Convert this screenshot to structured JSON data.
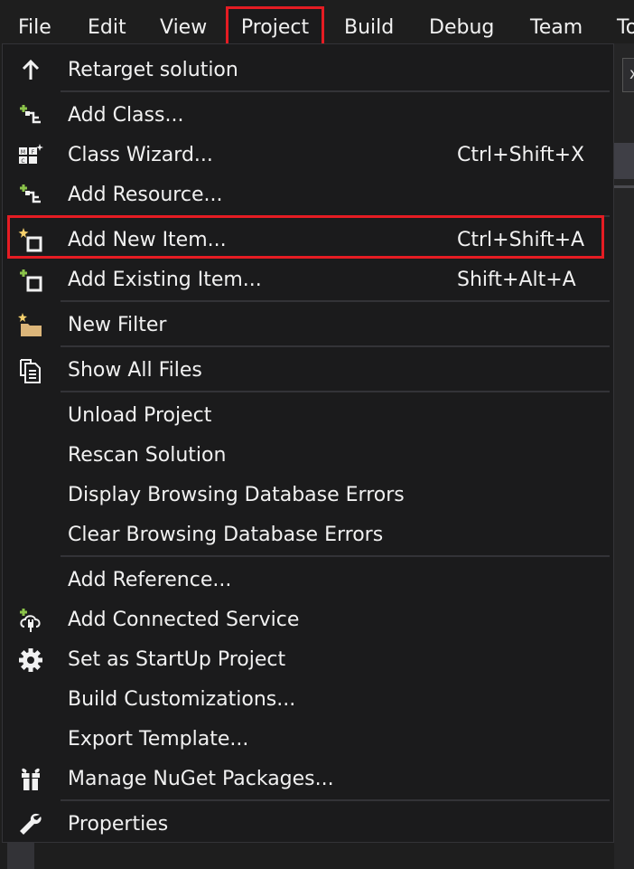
{
  "menubar": {
    "items": [
      {
        "label": "File"
      },
      {
        "label": "Edit"
      },
      {
        "label": "View"
      },
      {
        "label": "Project"
      },
      {
        "label": "Build"
      },
      {
        "label": "Debug"
      },
      {
        "label": "Team"
      },
      {
        "label": "To"
      }
    ]
  },
  "background": {
    "tab_close": "x"
  },
  "dropdown": {
    "items": [
      {
        "label": "Retarget solution",
        "shortcut": "",
        "icon": "arrow-up-icon"
      },
      {
        "label": "Add Class...",
        "shortcut": "",
        "icon": "add-class-icon"
      },
      {
        "label": "Class Wizard...",
        "shortcut": "Ctrl+Shift+X",
        "icon": "class-wizard-icon"
      },
      {
        "label": "Add Resource...",
        "shortcut": "",
        "icon": "add-resource-icon"
      },
      {
        "label": "Add New Item...",
        "shortcut": "Ctrl+Shift+A",
        "icon": "add-new-item-icon"
      },
      {
        "label": "Add Existing Item...",
        "shortcut": "Shift+Alt+A",
        "icon": "add-existing-item-icon"
      },
      {
        "label": "New Filter",
        "shortcut": "",
        "icon": "new-filter-folder-icon"
      },
      {
        "label": "Show All Files",
        "shortcut": "",
        "icon": "show-all-files-icon"
      },
      {
        "label": "Unload Project",
        "shortcut": "",
        "icon": ""
      },
      {
        "label": "Rescan Solution",
        "shortcut": "",
        "icon": ""
      },
      {
        "label": "Display Browsing Database Errors",
        "shortcut": "",
        "icon": ""
      },
      {
        "label": "Clear Browsing Database Errors",
        "shortcut": "",
        "icon": ""
      },
      {
        "label": "Add Reference...",
        "shortcut": "",
        "icon": ""
      },
      {
        "label": "Add Connected Service",
        "shortcut": "",
        "icon": "connected-service-icon"
      },
      {
        "label": "Set as StartUp Project",
        "shortcut": "",
        "icon": "gear-icon"
      },
      {
        "label": "Build Customizations...",
        "shortcut": "",
        "icon": ""
      },
      {
        "label": "Export Template...",
        "shortcut": "",
        "icon": ""
      },
      {
        "label": "Manage NuGet Packages...",
        "shortcut": "",
        "icon": "nuget-package-icon"
      },
      {
        "label": "Properties",
        "shortcut": "",
        "icon": "wrench-icon"
      }
    ]
  },
  "colors": {
    "highlight_border": "#e51c23",
    "menu_bg": "#1b1b1c",
    "text": "#f1f1f1",
    "add_green": "#8bc34a",
    "star_yellow": "#f5d06c"
  }
}
